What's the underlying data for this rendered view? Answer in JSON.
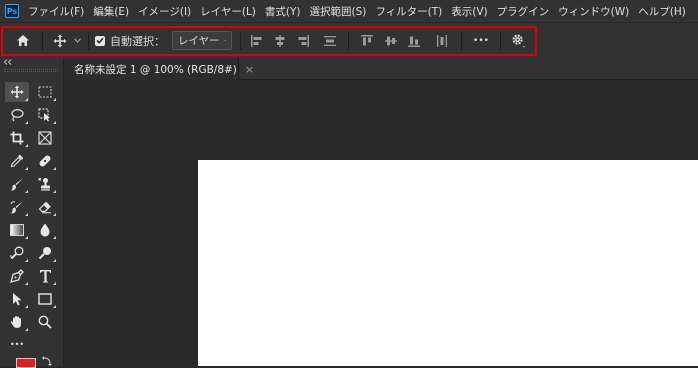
{
  "app": {
    "logo_text": "Ps"
  },
  "menu": [
    "ファイル(F)",
    "編集(E)",
    "イメージ(I)",
    "レイヤー(L)",
    "書式(Y)",
    "選択範囲(S)",
    "フィルター(T)",
    "表示(V)",
    "プラグイン",
    "ウィンドウ(W)",
    "ヘルプ(H)"
  ],
  "options": {
    "auto_select_label": "自動選択：",
    "auto_select_checked": true,
    "layer_dropdown": "レイヤー",
    "more_label": "•••"
  },
  "document_tab": {
    "title": "名称未設定 1 @ 100% (RGB/8#)",
    "close": "×"
  },
  "toolbar": {
    "more_label": "•••",
    "foreground_color": "#e02020"
  },
  "colors": {
    "highlight": "#e0000c",
    "panel": "#323232",
    "workspace": "#282828",
    "canvas": "#ffffff"
  }
}
